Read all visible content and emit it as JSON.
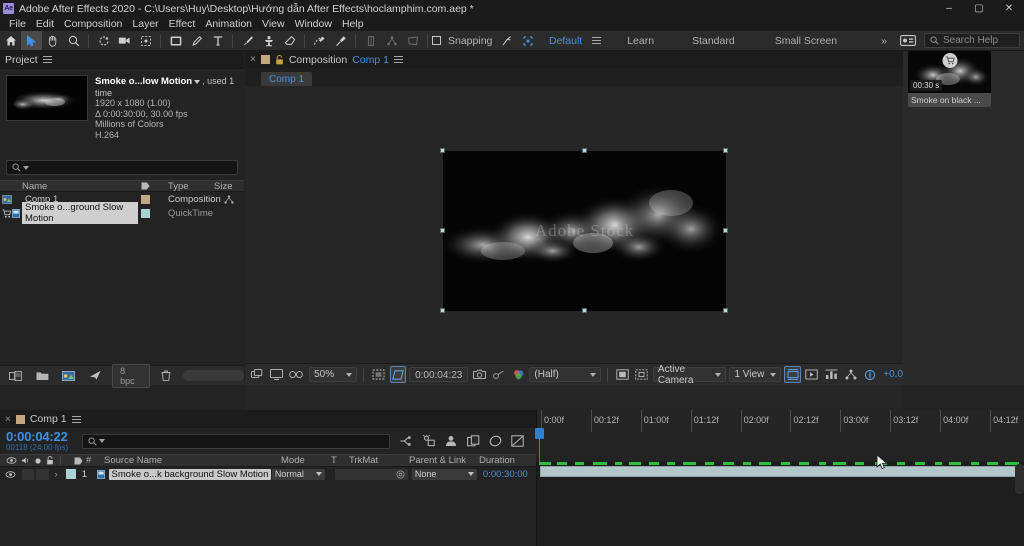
{
  "window": {
    "app_icon": "Ae",
    "title": "Adobe After Effects 2020 - C:\\Users\\Huy\\Desktop\\Hướng dẫn After Effects\\hoclamphim.com.aep *",
    "minimize": "–",
    "maximize": "▢",
    "close": "✕"
  },
  "menubar": {
    "items": [
      "File",
      "Edit",
      "Composition",
      "Layer",
      "Effect",
      "Animation",
      "View",
      "Window",
      "Help"
    ]
  },
  "toolbar": {
    "tools": [
      {
        "name": "home-icon",
        "label": "Home"
      },
      {
        "name": "selection-tool-icon",
        "label": "Selection Tool"
      },
      {
        "name": "hand-tool-icon",
        "label": "Hand Tool"
      },
      {
        "name": "zoom-tool-icon",
        "label": "Zoom Tool"
      },
      {
        "name": "rotation-tool-icon",
        "label": "Rotation Tool"
      },
      {
        "name": "camera-tool-icon",
        "label": "Camera Tool"
      },
      {
        "name": "pan-behind-tool-icon",
        "label": "Pan Behind Tool"
      },
      {
        "name": "shape-tool-icon",
        "label": "Rectangle Tool"
      },
      {
        "name": "pen-tool-icon",
        "label": "Pen Tool"
      },
      {
        "name": "type-tool-icon",
        "label": "Type Tool"
      },
      {
        "name": "brush-tool-icon",
        "label": "Brush Tool"
      },
      {
        "name": "clone-stamp-tool-icon",
        "label": "Clone Stamp Tool"
      },
      {
        "name": "eraser-tool-icon",
        "label": "Eraser Tool"
      },
      {
        "name": "roto-brush-tool-icon",
        "label": "Roto Brush Tool"
      },
      {
        "name": "puppet-pin-tool-icon",
        "label": "Puppet Pin Tool"
      }
    ],
    "axis_tools": [
      "local-axis-icon",
      "world-axis-icon",
      "view-axis-icon"
    ],
    "snapping_label": "Snapping",
    "snap_extras": [
      "snap-arrow-icon",
      "snap-grid-icon"
    ],
    "workspaces": [
      "Default",
      "Learn",
      "Standard",
      "Small Screen"
    ],
    "workspace_active": "Default",
    "overflow": "»",
    "workspace_menu_icon": "workspace-menu-icon",
    "tool_panel_icon": "tool-panel-icon",
    "search_placeholder": "Search Help"
  },
  "project_panel": {
    "tab_title": "Project",
    "menu_icon": "panel-menu-icon",
    "item": {
      "name": "Smoke o...low Motion",
      "used": ", used 1 time",
      "resolution": "1920 x 1080 (1.00)",
      "duration": "Δ 0:00:30:00, 30.00 fps",
      "colors": "Millions of Colors",
      "codec": "H.264"
    },
    "search_placeholder": "",
    "columns": [
      "Name",
      "Type",
      "Size"
    ],
    "rows": [
      {
        "name": "Comp 1",
        "type": "Composition",
        "size": "",
        "selected": false,
        "swatch": "#c4a882",
        "icon": "composition-icon"
      },
      {
        "name": "Smoke o...ground Slow Motion",
        "type": "QuickTime",
        "size": "",
        "selected": true,
        "swatch": "#aad4d4",
        "icon": "footage-icon"
      }
    ],
    "footer": {
      "bit_depth": "8 bpc",
      "icons": [
        "interpret-footage-icon",
        "new-folder-icon",
        "new-composition-icon",
        "project-settings-icon",
        "delete-icon"
      ]
    }
  },
  "comp_panel": {
    "close_icon": "close-tab-icon",
    "swatch": "#c4a882",
    "lock_icon": "lock-icon",
    "label": "Composition",
    "comp_name": "Comp 1",
    "menu_icon": "panel-menu-icon",
    "tab_label": "Comp 1",
    "viewer": {
      "watermark": "Adobe Stock"
    },
    "footer": {
      "zoom": "50%",
      "timecode": "0:00:04:23",
      "resolution": "(Half)",
      "view": "Active Camera",
      "views": "1 View",
      "exposure": "+0.0",
      "icons_left": [
        "always-preview-icon",
        "main-viewer-icon",
        "3d-glasses-icon"
      ],
      "icons_mid": [
        "region-of-interest-icon",
        "transparency-grid-icon",
        "take-snapshot-icon",
        "show-snapshot-icon",
        "channel-icon"
      ],
      "icons_right": [
        "toggle-mask-icon",
        "timeline-icon",
        "comp-flowchart-icon",
        "renderer-icon",
        "reset-exposure-icon"
      ]
    }
  },
  "right_panel": {
    "media_card": {
      "badge": "00:30 s",
      "caption": "Smoke on black ...",
      "cart_icon": "shopping-cart-icon"
    }
  },
  "timeline_panel": {
    "close_icon": "close-tab-icon",
    "swatch": "#c4a882",
    "tab_title": "Comp 1",
    "menu_icon": "panel-menu-icon",
    "current_time": "0:00:04:22",
    "frames": "00118 (24.00 fps)",
    "search_placeholder": "",
    "toolbar_icons": [
      "composition-mini-flowchart-icon",
      "draft-3d-icon",
      "hide-shy-layers-icon",
      "frame-blending-icon",
      "motion-blur-icon",
      "graph-editor-icon"
    ],
    "switch_icons": [
      "video-eye-icon",
      "audio-icon",
      "solo-icon",
      "lock-icon"
    ],
    "columns": {
      "label_icon": "label-color-icon",
      "index": "#",
      "source_name": "Source Name",
      "mode": "Mode",
      "t": "T",
      "trkmat": "TrkMat",
      "parent": "Parent & Link",
      "duration": "Duration"
    },
    "layers": [
      {
        "index": "1",
        "source_name": "Smoke o...k background Slow Motion",
        "mode": "Normal",
        "trkmat": "",
        "parent": "None",
        "duration": "0:00:30:00",
        "label_color": "#aad4d4",
        "selected": true
      }
    ],
    "ruler_labels": [
      "0:00f",
      "00:12f",
      "01:00f",
      "01:12f",
      "02:00f",
      "02:12f",
      "03:00f",
      "03:12f",
      "04:00f",
      "04:12f"
    ]
  },
  "colors": {
    "accent_blue": "#3e8fe0",
    "panel_bg": "#232323",
    "toolbar_bg": "#2b2b2b",
    "titlebar_bg": "#1b1b1b",
    "layer_bar": "#b3c7ca",
    "cache_green": "#2fbf3f"
  }
}
